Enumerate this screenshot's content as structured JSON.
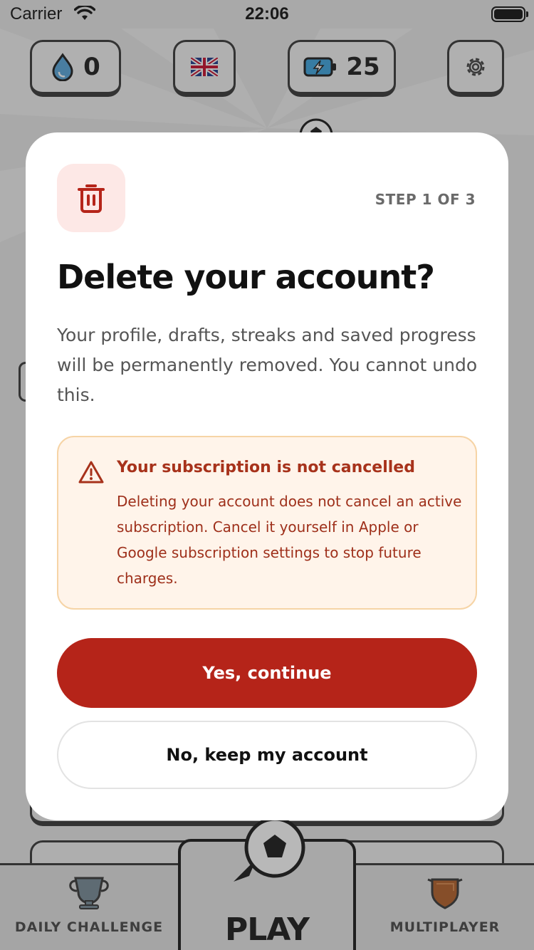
{
  "status_bar": {
    "carrier": "Carrier",
    "time": "22:06"
  },
  "hud": {
    "water_count": "0",
    "energy_count": "25",
    "water_icon": "water-drop-icon",
    "flag_icon": "uk-flag-icon",
    "energy_icon": "battery-bolt-icon",
    "settings_icon": "gear-icon"
  },
  "tabs": {
    "daily": "DAILY CHALLENGE",
    "play": "PLAY",
    "multiplayer": "MULTIPLAYER"
  },
  "modal": {
    "step": "STEP 1 OF 3",
    "title": "Delete your account?",
    "body": "Your profile, drafts, streaks and saved progress will be permanently removed. You cannot undo this.",
    "warning": {
      "title": "Your subscription is not cancelled",
      "body": "Deleting your account does not cancel an active subscription. Cancel it yourself in Apple or Google subscription settings to stop future charges."
    },
    "confirm_label": "Yes, continue",
    "cancel_label": "No, keep my account"
  },
  "colors": {
    "accent": "#b52419",
    "warning_bg": "#fff4ea",
    "warning_text": "#a7321b",
    "trash_bg": "#fde8e6"
  }
}
